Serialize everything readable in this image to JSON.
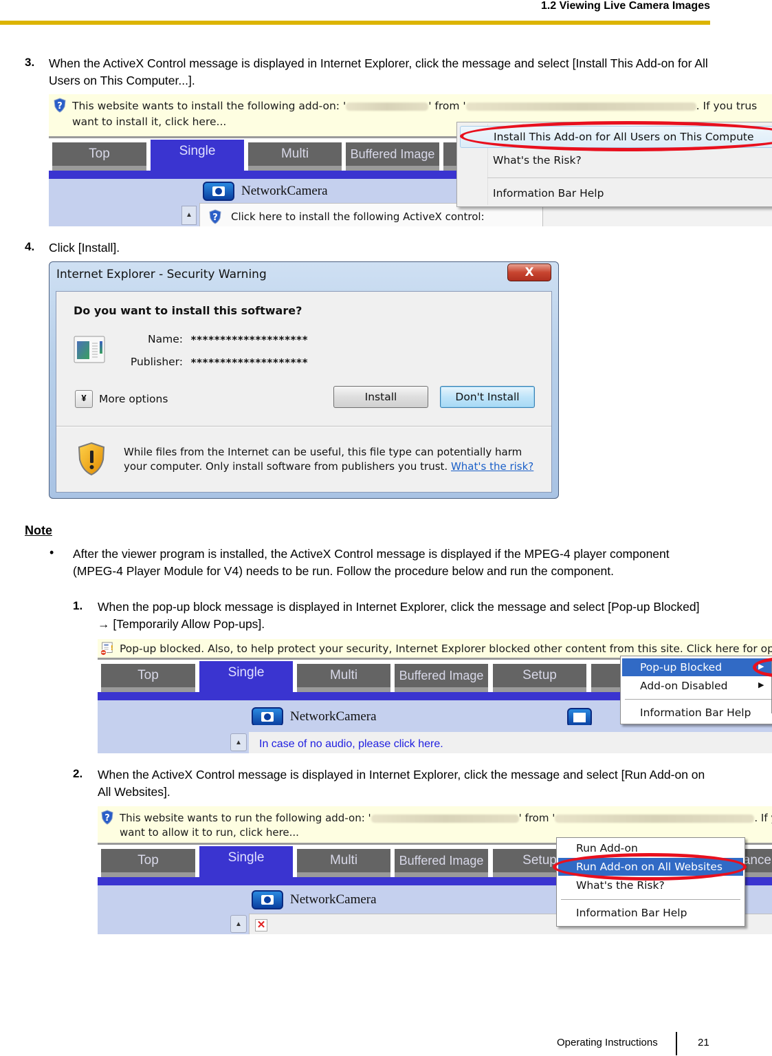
{
  "header": {
    "section_title": "1.2 Viewing Live Camera Images"
  },
  "step3": {
    "number": "3.",
    "text": "When the ActiveX Control message is displayed in Internet Explorer, click the message and select [Install This Add-on for All Users on This Computer...].",
    "screenshot": {
      "infobar_line1_a": "This website wants to install the following add-on: '",
      "infobar_line1_b": "' from '",
      "infobar_line1_c": ". If you trus",
      "infobar_line2": "want to install it, click here...",
      "tabs": [
        "Top",
        "Single",
        "Multi",
        "Buffered Image"
      ],
      "active_tab": "Single",
      "camera_title": "NetworkCamera",
      "activex_prompt": "Click here to install the following ActiveX control:",
      "menu_items": [
        "Install This Add-on for All Users on This Compute",
        "What's the Risk?",
        "Information Bar Help"
      ],
      "highlighted_item": "Install This Add-on for All Users on This Computer..."
    }
  },
  "step4": {
    "number": "4.",
    "text": "Click [Install].",
    "dialog": {
      "title": "Internet Explorer - Security Warning",
      "close_label": "X",
      "question": "Do you want to install this software?",
      "name_label": "Name:",
      "name_value": "********************",
      "publisher_label": "Publisher:",
      "publisher_value": "********************",
      "more_options": "More options",
      "install_button": "Install",
      "dont_install_button": "Don't Install",
      "warning_text": "While files from the Internet can be useful, this file type can potentially harm your computer. Only install software from publishers you trust.",
      "risk_link": "What's the risk?"
    }
  },
  "note": {
    "title": "Note",
    "bullet": "•",
    "text": "After the viewer program is installed, the ActiveX Control message is displayed if the MPEG-4 player component (MPEG-4 Player Module for V4) needs to be run. Follow the procedure below and run the component.",
    "sub1": {
      "number": "1.",
      "text": "When the pop-up block message is displayed in Internet Explorer, click the message and select [Pop-up Blocked] → [Temporarily Allow Pop-ups].",
      "screenshot": {
        "infobar": "Pop-up blocked. Also, to help protect your security, Internet Explorer blocked other content from this site. Click here for optio",
        "tabs": [
          "Top",
          "Single",
          "Multi",
          "Buffered Image",
          "Setup"
        ],
        "active_tab": "Single",
        "camera_title": "NetworkCamera",
        "audio_link": "In case of no audio, please click here.",
        "menu_items": [
          "Pop-up Blocked",
          "Add-on Disabled",
          "Information Bar Help"
        ],
        "selected_item": "Pop-up Blocked"
      }
    },
    "sub2": {
      "number": "2.",
      "text": "When the ActiveX Control message is displayed in Internet Explorer, click the message and select [Run Add-on on All Websites].",
      "screenshot": {
        "infobar_line1_a": "This website wants to run the following add-on: '",
        "infobar_line1_b": "' from '",
        "infobar_line1_c": ". If yo",
        "infobar_line2": "want to allow it to run, click here...",
        "tabs": [
          "Top",
          "Single",
          "Multi",
          "Buffered Image",
          "Setup",
          "ance"
        ],
        "active_tab": "Single",
        "camera_title": "NetworkCamera",
        "menu_items": [
          "Run Add-on",
          "Run Add-on on All Websites",
          "What's the Risk?",
          "Information Bar Help"
        ],
        "selected_item": "Run Add-on on All Websites"
      }
    }
  },
  "footer": {
    "doc_title": "Operating Instructions",
    "page_number": "21"
  },
  "colors": {
    "header_rule": "#dcb400",
    "tab_active": "#3a34d0",
    "tab_inactive": "#646464",
    "highlight_ellipse": "#e8101e",
    "xp_selection": "#316ac5"
  }
}
